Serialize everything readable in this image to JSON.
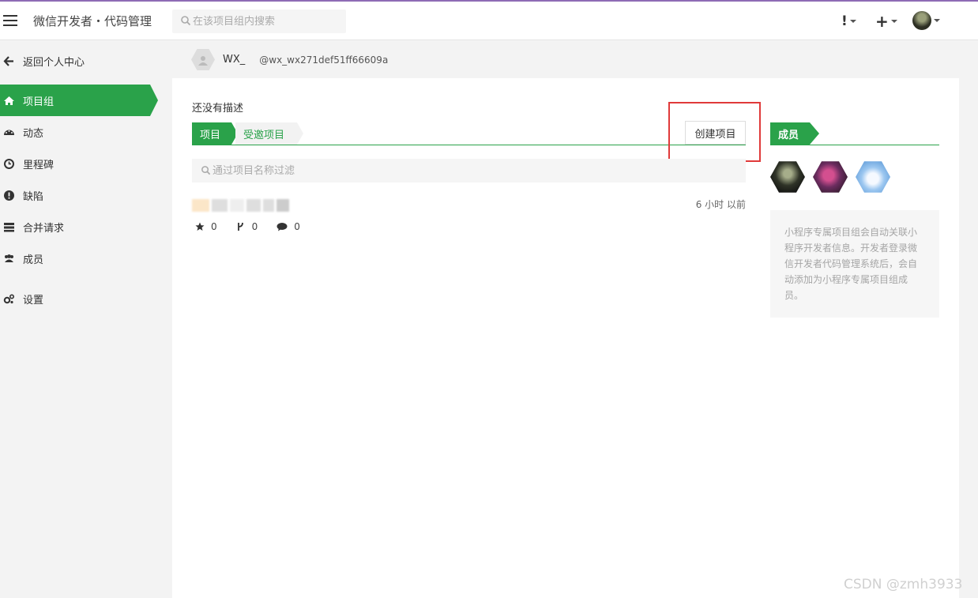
{
  "colors": {
    "accent": "#2aa24a",
    "highlight": "#e03a3a",
    "topbar_border": "#8e6bb5"
  },
  "header": {
    "menu_icon": "hamburger-icon",
    "title": "微信开发者・代码管理",
    "search_placeholder": "在该项目组内搜索",
    "alert_label": "!",
    "plus_label": "+"
  },
  "sidebar": {
    "back_label": "返回个人中心",
    "items": [
      {
        "icon": "home-icon",
        "label": "项目组",
        "active": true
      },
      {
        "icon": "dashboard-icon",
        "label": "动态"
      },
      {
        "icon": "clock-icon",
        "label": "里程碑"
      },
      {
        "icon": "alert-icon",
        "label": "缺陷"
      },
      {
        "icon": "merge-icon",
        "label": "合并请求"
      },
      {
        "icon": "users-icon",
        "label": "成员"
      },
      {
        "icon": "gears-icon",
        "label": "设置"
      }
    ]
  },
  "user": {
    "name": "WX_",
    "handle": "@wx_wx271def51ff66609a"
  },
  "main": {
    "description": "还没有描述",
    "tabs": [
      {
        "label": "项目",
        "active": true
      },
      {
        "label": "受邀项目"
      }
    ],
    "create_button": "创建项目",
    "filter_placeholder": "通过项目名称过滤",
    "project": {
      "time": "6 小时 以前",
      "stars": "0",
      "forks": "0",
      "comments": "0"
    }
  },
  "members": {
    "tab_label": "成员",
    "info": "小程序专属项目组会自动关联小程序开发者信息。开发者登录微信开发者代码管理系统后，会自动添加为小程序专属项目组成员。"
  },
  "watermark": "CSDN @zmh3933"
}
